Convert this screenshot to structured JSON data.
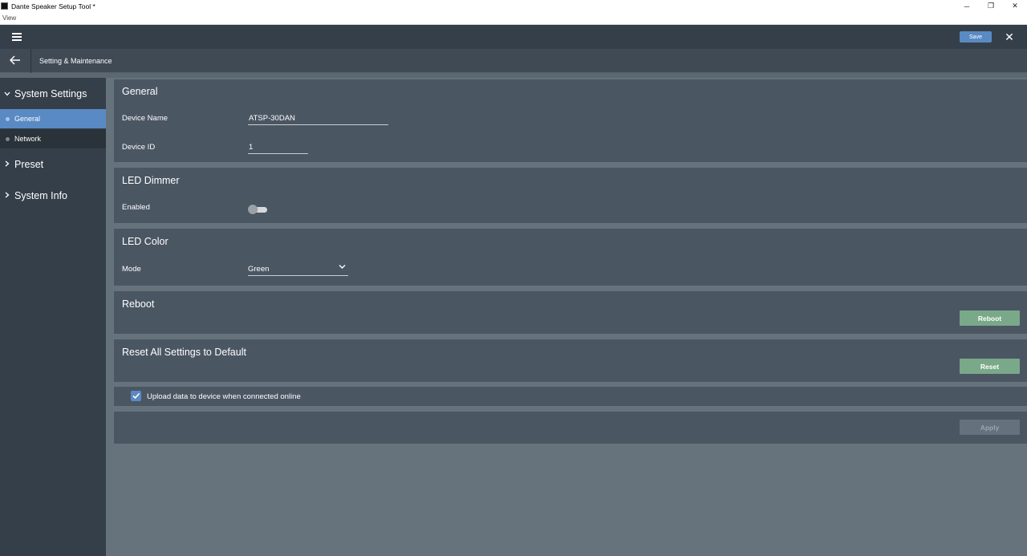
{
  "window": {
    "title": "Dante Speaker Setup Tool *",
    "minimize_glyph": "─",
    "restore_glyph": "❐",
    "close_glyph": "✕"
  },
  "menu": {
    "view_label": "View"
  },
  "appbar": {
    "save_label": "Save",
    "menu_icon": "hamburger-icon",
    "close_icon": "close-icon"
  },
  "header": {
    "title": "Setting & Maintenance",
    "back_icon": "arrow-left-icon"
  },
  "sidebar": {
    "sections": [
      {
        "label": "System Settings",
        "expanded": true
      },
      {
        "label": "Preset",
        "expanded": false
      },
      {
        "label": "System Info",
        "expanded": false
      }
    ],
    "items": [
      {
        "label": "General",
        "active": true
      },
      {
        "label": "Network",
        "active": false
      }
    ]
  },
  "general": {
    "title": "General",
    "device_name_label": "Device Name",
    "device_name_value": "ATSP-30DAN",
    "device_id_label": "Device ID",
    "device_id_value": "1"
  },
  "led_dimmer": {
    "title": "LED Dimmer",
    "enabled_label": "Enabled",
    "enabled": false
  },
  "led_color": {
    "title": "LED Color",
    "mode_label": "Mode",
    "mode_value": "Green"
  },
  "reboot": {
    "title": "Reboot",
    "button_label": "Reboot"
  },
  "reset": {
    "title": "Reset All Settings to Default",
    "button_label": "Reset"
  },
  "upload": {
    "label": "Upload data to device when connected online",
    "checked": true
  },
  "apply": {
    "button_label": "Apply"
  },
  "colors": {
    "accent": "#5a8ac4",
    "action_green": "#7aa98a",
    "panel": "#4b5663",
    "sidebar": "#353f49"
  }
}
